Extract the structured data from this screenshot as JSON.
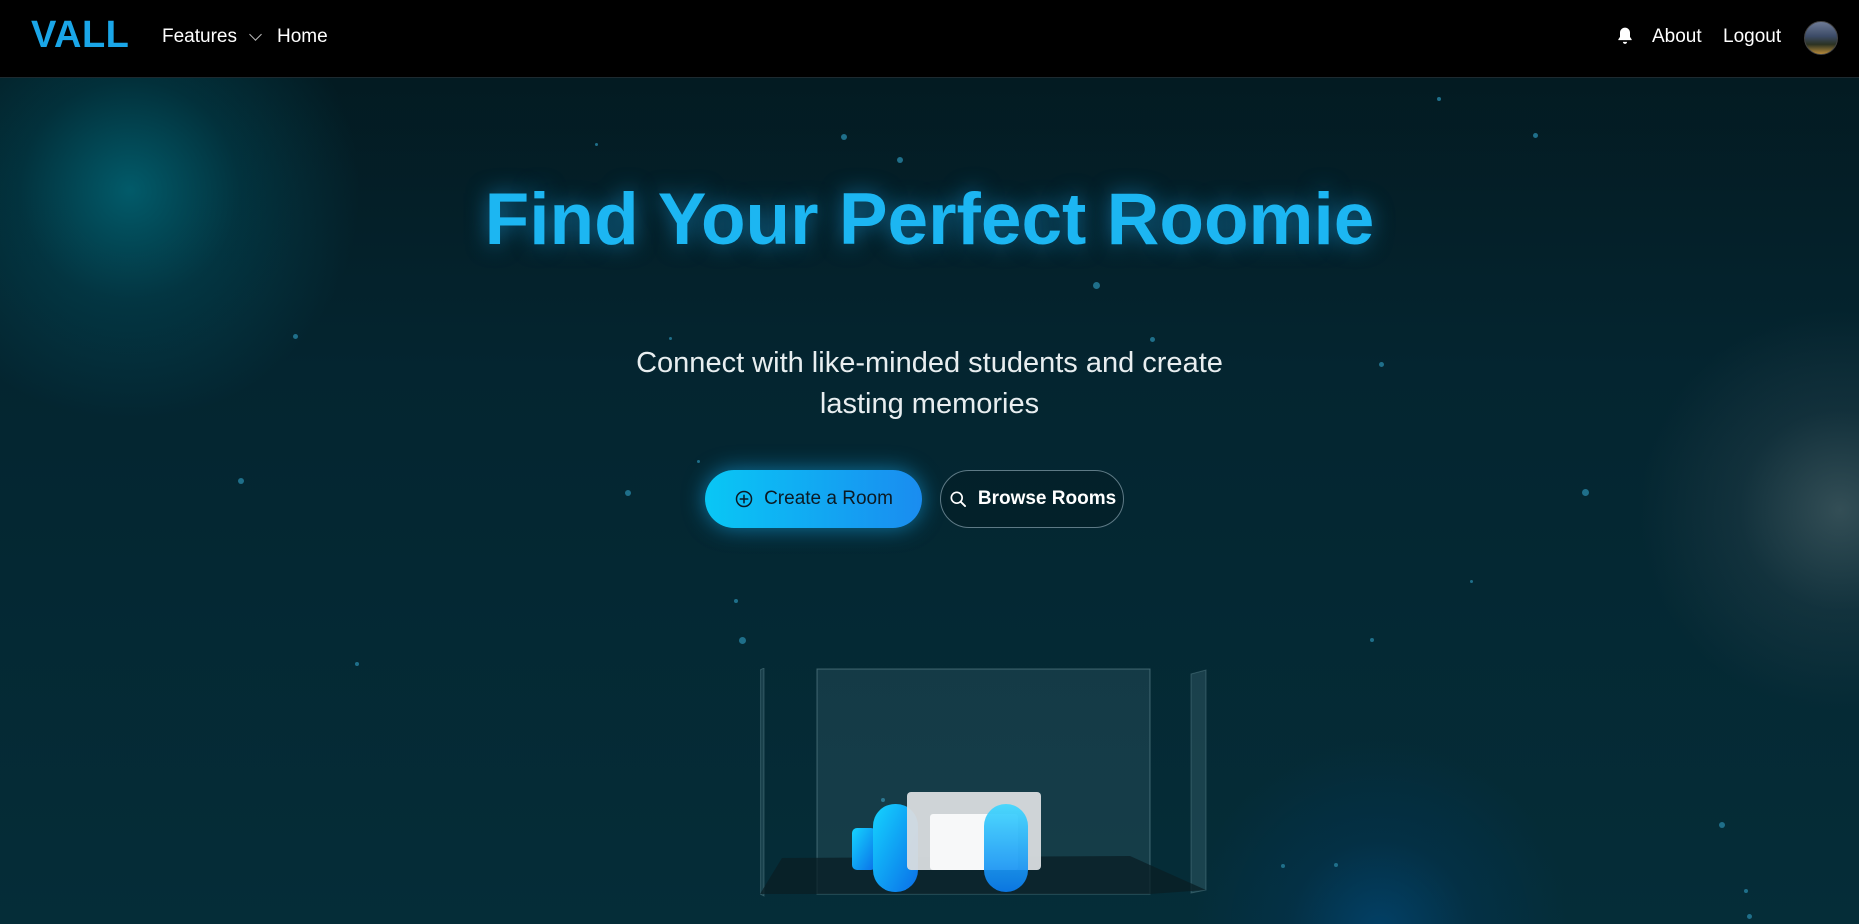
{
  "brand": {
    "logo": "VALL"
  },
  "nav": {
    "features_label": "Features",
    "home_label": "Home",
    "about_label": "About",
    "logout_label": "Logout"
  },
  "hero": {
    "title": "Find Your Perfect Roomie",
    "subtitle": "Connect with like-minded students and create lasting memories",
    "create_button": "Create a Room",
    "browse_button": "Browse Rooms"
  },
  "icons": {
    "nav": [
      "chevron-down-icon",
      "bell-icon",
      "avatar"
    ],
    "buttons": [
      "plus-circle-icon",
      "search-icon"
    ]
  },
  "colors": {
    "accent": "#1cb6f2",
    "button_gradient_start": "#09c7f5",
    "button_gradient_end": "#1a8cf0",
    "nav_background": "#000000",
    "page_background": "#032029"
  }
}
